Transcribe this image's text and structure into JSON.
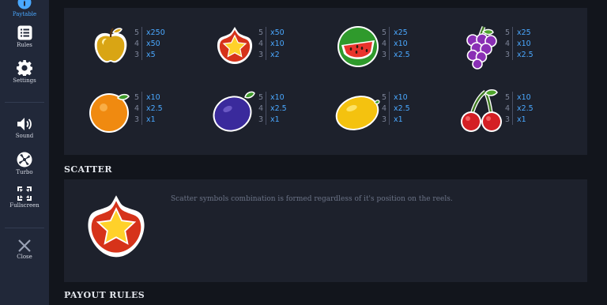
{
  "sidebar": {
    "items": [
      {
        "label": "Paytable",
        "icon": "info-icon",
        "active": true
      },
      {
        "label": "Rules",
        "icon": "list-icon"
      },
      {
        "label": "Settings",
        "icon": "gear-icon"
      },
      {
        "label": "Sound",
        "icon": "speaker-icon"
      },
      {
        "label": "Turbo",
        "icon": "turbo-icon"
      },
      {
        "label": "Fullscreen",
        "icon": "fullscreen-icon"
      },
      {
        "label": "Close",
        "icon": "close-icon"
      }
    ]
  },
  "sections": {
    "scatter_title": "SCATTER",
    "payout_rules_title": "PAYOUT RULES"
  },
  "symbols": [
    {
      "name": "apple-icon",
      "payouts": [
        {
          "count": "5",
          "mult": "x250"
        },
        {
          "count": "4",
          "mult": "x50"
        },
        {
          "count": "3",
          "mult": "x5"
        }
      ]
    },
    {
      "name": "star-icon",
      "payouts": [
        {
          "count": "5",
          "mult": "x50"
        },
        {
          "count": "4",
          "mult": "x10"
        },
        {
          "count": "3",
          "mult": "x2"
        }
      ]
    },
    {
      "name": "watermelon-icon",
      "payouts": [
        {
          "count": "5",
          "mult": "x25"
        },
        {
          "count": "4",
          "mult": "x10"
        },
        {
          "count": "3",
          "mult": "x2.5"
        }
      ]
    },
    {
      "name": "grapes-icon",
      "payouts": [
        {
          "count": "5",
          "mult": "x25"
        },
        {
          "count": "4",
          "mult": "x10"
        },
        {
          "count": "3",
          "mult": "x2.5"
        }
      ]
    },
    {
      "name": "orange-icon",
      "payouts": [
        {
          "count": "5",
          "mult": "x10"
        },
        {
          "count": "4",
          "mult": "x2.5"
        },
        {
          "count": "3",
          "mult": "x1"
        }
      ]
    },
    {
      "name": "plum-icon",
      "payouts": [
        {
          "count": "5",
          "mult": "x10"
        },
        {
          "count": "4",
          "mult": "x2.5"
        },
        {
          "count": "3",
          "mult": "x1"
        }
      ]
    },
    {
      "name": "lemon-icon",
      "payouts": [
        {
          "count": "5",
          "mult": "x10"
        },
        {
          "count": "4",
          "mult": "x2.5"
        },
        {
          "count": "3",
          "mult": "x1"
        }
      ]
    },
    {
      "name": "cherries-icon",
      "payouts": [
        {
          "count": "5",
          "mult": "x10"
        },
        {
          "count": "4",
          "mult": "x2.5"
        },
        {
          "count": "3",
          "mult": "x1"
        }
      ]
    }
  ],
  "scatter": {
    "icon": "scatter-star-icon",
    "description": "Scatter symbols combination is formed regardless of it's position on the reels."
  },
  "colors": {
    "accent": "#4aa8ff",
    "sidebar_bg": "#212839",
    "panel_bg": "#1d212c",
    "page_bg": "#12151c"
  }
}
